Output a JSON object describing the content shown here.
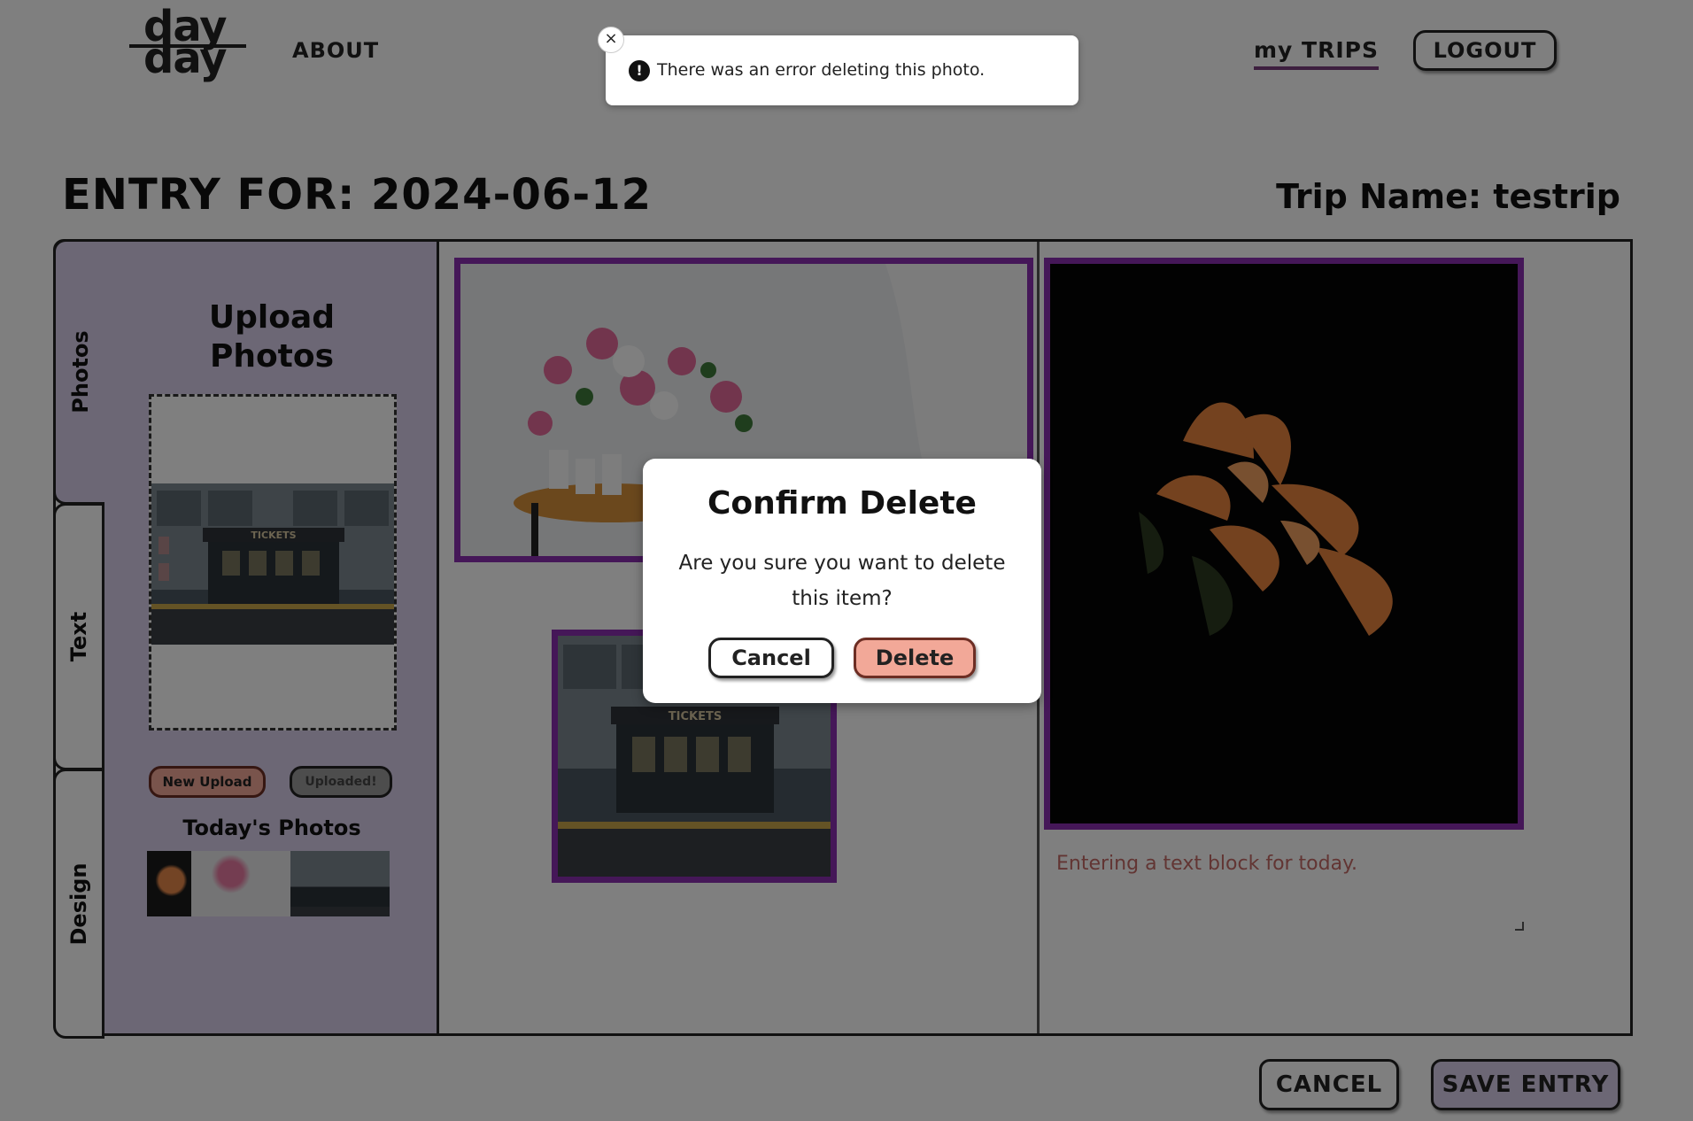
{
  "header": {
    "logo_line1": "day",
    "logo_line2": "day",
    "nav_about": "ABOUT",
    "nav_my_trips": "my TRIPS",
    "logout_label": "LOGOUT"
  },
  "page": {
    "entry_title": "ENTRY FOR: 2024-06-12",
    "trip_name": "Trip Name: testrip"
  },
  "tabs": [
    {
      "label": "Photos",
      "active": true
    },
    {
      "label": "Text",
      "active": false
    },
    {
      "label": "Design",
      "active": false
    }
  ],
  "upload_panel": {
    "title_line1": "Upload",
    "title_line2": "Photos",
    "new_upload_label": "New Upload",
    "uploaded_label": "Uploaded!",
    "todays_photos_label": "Today's Photos",
    "thumbnails": [
      "orange-flower-photo",
      "pink-flowers-photo",
      "tickets-building-photo"
    ]
  },
  "canvas": {
    "photos": [
      "pink-flowers-photo",
      "tickets-building-photo",
      "orange-flower-photo"
    ],
    "text_block": "Entering a text block for today.",
    "tickets_sign": "TICKETS"
  },
  "footer": {
    "cancel_label": "CANCEL",
    "save_label": "SAVE ENTRY"
  },
  "toast": {
    "message": "There was an error deleting this photo.",
    "close_glyph": "×",
    "icon_glyph": "!"
  },
  "modal": {
    "title": "Confirm Delete",
    "message": "Are you sure you want to delete this item?",
    "cancel_label": "Cancel",
    "delete_label": "Delete"
  },
  "colors": {
    "accent_purple": "#8b2fb0",
    "panel_lavender": "#d8cfeb",
    "danger_salmon": "#f2a898",
    "text_block_color": "#c46a66"
  }
}
